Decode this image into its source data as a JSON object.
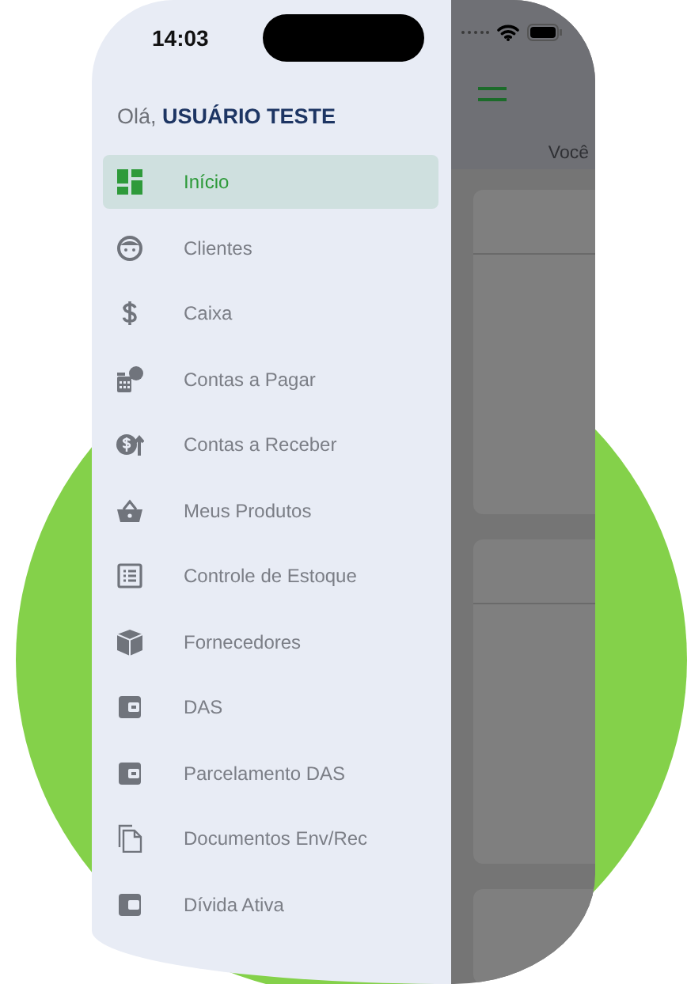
{
  "status_bar": {
    "time": "14:03"
  },
  "drawer": {
    "greeting": "Olá, **USUÁRIO TESTE**",
    "items": [
      {
        "label": "Início",
        "selected": true
      },
      {
        "label": "Clientes",
        "selected": false
      },
      {
        "label": "Caixa",
        "selected": false
      },
      {
        "label": "Contas a Pagar",
        "selected": false
      },
      {
        "label": "Contas a Receber",
        "selected": false
      },
      {
        "label": "Meus Produtos",
        "selected": false
      },
      {
        "label": "Controle de Estoque",
        "selected": false
      },
      {
        "label": "Fornecedores",
        "selected": false
      },
      {
        "label": "DAS",
        "selected": false
      },
      {
        "label": "Parcelamento DAS",
        "selected": false
      },
      {
        "label": "Documentos Env/Rec",
        "selected": false
      },
      {
        "label": "Dívida Ativa",
        "selected": false
      }
    ]
  },
  "background_screen": {
    "greeting_text": "Você"
  }
}
